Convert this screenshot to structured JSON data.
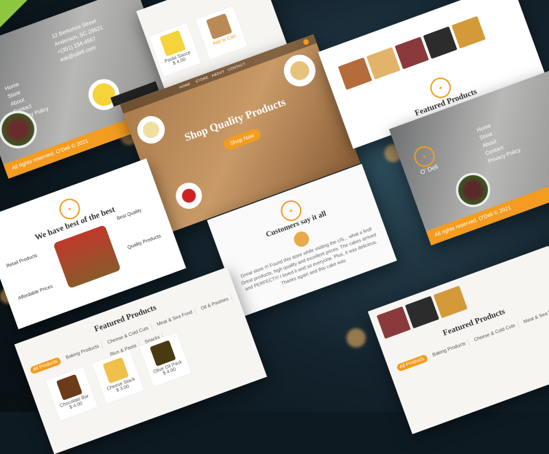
{
  "footer": {
    "address_lines": [
      "12 Berkshire Street",
      "Anderson, SC 29621",
      "+(351) 234-4567",
      "ask@odeli.com"
    ],
    "links": [
      "Home",
      "Store",
      "About",
      "Contact",
      "Privacy Policy"
    ],
    "copyright": "All rights reserved. O'Deli © 2021"
  },
  "hero": {
    "nav": [
      "HOME",
      "STORE",
      "ABOUT",
      "CONTACT"
    ],
    "title": "Shop Quality Products",
    "cta": "Shop Now"
  },
  "features": {
    "title": "We have best of the best",
    "items": [
      "Best Quality",
      "Quality Products",
      "Retail Products",
      "Affordable Prices"
    ]
  },
  "featured": {
    "title": "Featured Products",
    "tabs": [
      "All Products",
      "Baking Products",
      "Cheese & Cold Cuts",
      "Meat & Sea Food",
      "Oil & Pastries",
      "Rice & Pasta",
      "Snacks"
    ],
    "products": [
      {
        "name": "Pasta Sauce",
        "price": "$ 4.00"
      },
      {
        "name": "Chocolate Bar",
        "price": "$ 4.00"
      },
      {
        "name": "Cheese Stack",
        "price": "$ 3.00"
      },
      {
        "name": "Olive Oil Pack",
        "price": "$ 4.00"
      }
    ],
    "add_to_cart": "Add to Cart"
  },
  "testimonials": {
    "title": "Customers say it all",
    "quote": "Great store !!! Found this store while visiting the US... what a find! Great products, high quality and excellent prices. The cakes arrived and PERFECT!!! I loved it and so everyone. Plus, it was delicious. Thanks again and this cake was"
  },
  "brand": {
    "name": "O' Deli"
  },
  "colors": {
    "accent": "#f39c1f",
    "background": "#0e1a22",
    "footer_gray": "#9a9a98"
  }
}
